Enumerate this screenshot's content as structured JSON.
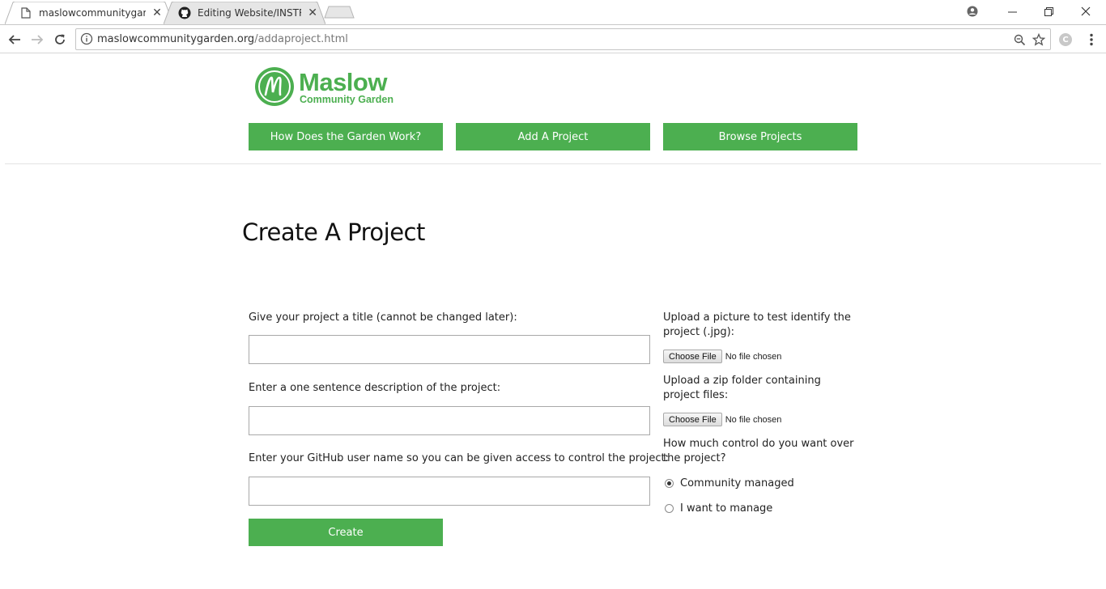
{
  "browser": {
    "tabs": [
      {
        "title": "maslowcommunitygarde",
        "active": true,
        "icon": "document-icon"
      },
      {
        "title": "Editing Website/INSTRUC",
        "active": false,
        "icon": "github-icon"
      }
    ],
    "address": {
      "host": "maslowcommunitygarden.org",
      "path": "/addaproject.html"
    },
    "extension_letter": "C"
  },
  "site": {
    "logo": {
      "name": "Maslow",
      "subtitle": "Community Garden",
      "color": "#4caf50"
    },
    "nav": [
      {
        "label": "How Does the Garden Work?"
      },
      {
        "label": "Add A Project"
      },
      {
        "label": "Browse Projects"
      }
    ]
  },
  "form": {
    "heading": "Create A Project",
    "title_label": "Give your project a title (cannot be changed later):",
    "title_value": "",
    "description_label": "Enter a one sentence description of the project:",
    "description_value": "",
    "github_label": "Enter your GitHub user name so you can be given access to control the project:",
    "github_value": "",
    "create_label": "Create",
    "picture_label": "Upload a picture to test identify the project (.jpg):",
    "zip_label": "Upload a zip folder containing project files:",
    "choose_file_label": "Choose File",
    "no_file_label": "No file chosen",
    "control_label": "How much control do you want over the project?",
    "control_options": [
      {
        "label": "Community managed",
        "checked": true
      },
      {
        "label": "I want to manage",
        "checked": false
      }
    ]
  }
}
